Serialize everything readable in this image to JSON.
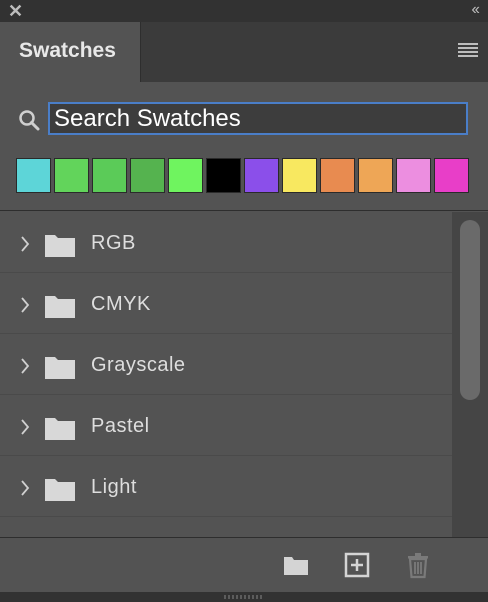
{
  "window": {
    "close_glyph": "✕",
    "collapse_glyph": "‹‹"
  },
  "panel": {
    "tab_label": "Swatches",
    "menu_icon": "panel-menu-icon"
  },
  "search": {
    "placeholder": "Search Swatches",
    "value": "",
    "icon": "search-icon"
  },
  "recent_swatches": [
    "#5dd5d8",
    "#62d45b",
    "#5bcb58",
    "#55b34f",
    "#6ff45f",
    "#000000",
    "#8b4fea",
    "#f8e860",
    "#e88b50",
    "#eea656",
    "#ec8ee0",
    "#e83ec8"
  ],
  "groups": [
    {
      "label": "RGB"
    },
    {
      "label": "CMYK"
    },
    {
      "label": "Grayscale"
    },
    {
      "label": "Pastel"
    },
    {
      "label": "Light"
    }
  ],
  "footer": {
    "buttons": [
      "new-group-icon",
      "new-swatch-icon",
      "delete-icon"
    ]
  },
  "colors": {
    "panel_bg": "#535353",
    "dark_chrome": "#323232",
    "focus_accent": "#4a7ec8"
  }
}
